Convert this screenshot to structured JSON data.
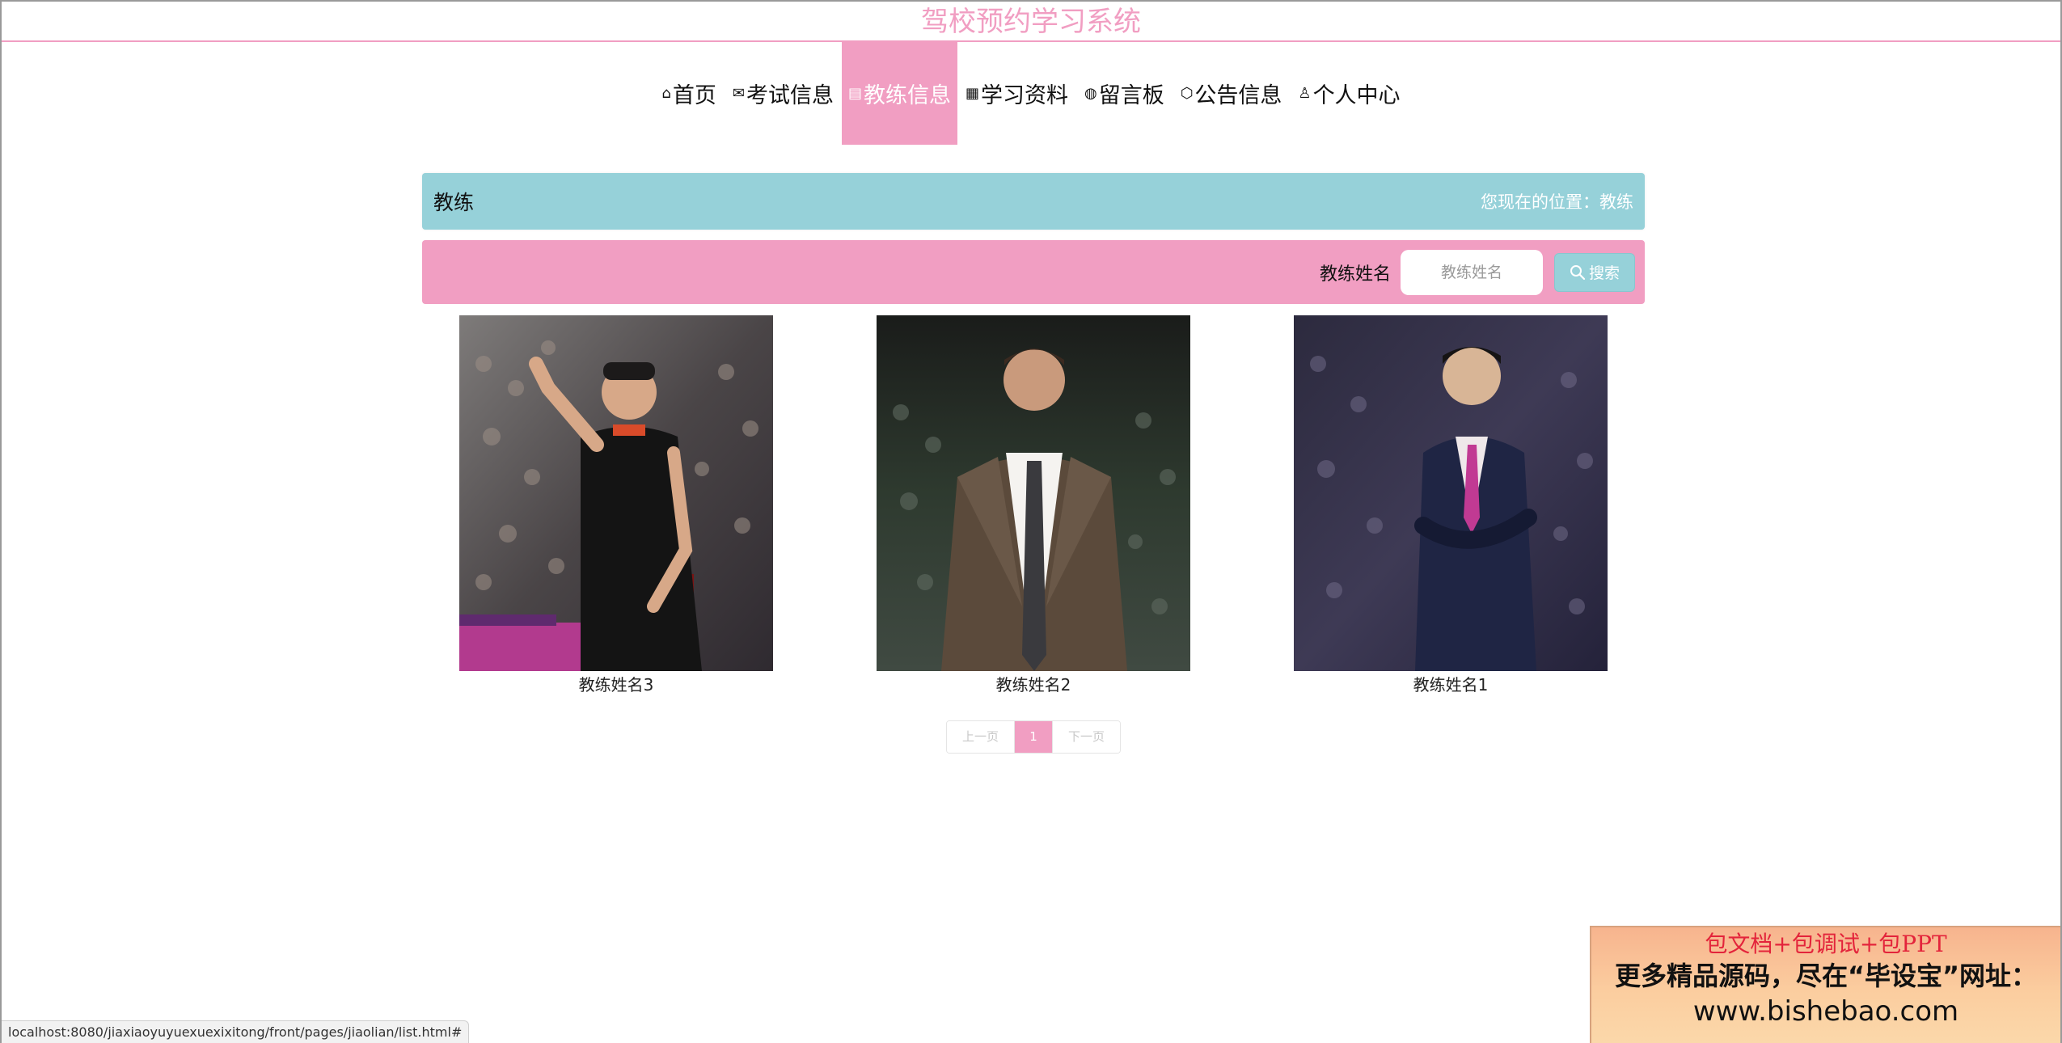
{
  "header": {
    "site_title": "驾校预约学习系统"
  },
  "nav": {
    "items": [
      {
        "label": "首页",
        "icon": "home-icon",
        "glyph": "⌂",
        "active": false
      },
      {
        "label": "考试信息",
        "icon": "mail-icon",
        "glyph": "✉",
        "active": false
      },
      {
        "label": "教练信息",
        "icon": "calendar-icon",
        "glyph": "▤",
        "active": true
      },
      {
        "label": "学习资料",
        "icon": "grid-icon",
        "glyph": "▦",
        "active": false
      },
      {
        "label": "留言板",
        "icon": "globe-icon",
        "glyph": "◍",
        "active": false
      },
      {
        "label": "公告信息",
        "icon": "box-icon",
        "glyph": "⬡",
        "active": false
      },
      {
        "label": "个人中心",
        "icon": "user-icon",
        "glyph": "♙",
        "active": false
      }
    ]
  },
  "banner": {
    "title": "教练",
    "breadcrumb": "您现在的位置：教练"
  },
  "search": {
    "label": "教练姓名",
    "placeholder": "教练姓名",
    "button_label": "搜索"
  },
  "coaches": [
    {
      "name": "教练姓名3"
    },
    {
      "name": "教练姓名2"
    },
    {
      "name": "教练姓名1"
    }
  ],
  "pagination": {
    "prev_label": "上一页",
    "current_page": "1",
    "next_label": "下一页"
  },
  "status_bar": {
    "url": "localhost:8080/jiaxiaoyuyuexuexixitong/front/pages/jiaolian/list.html#"
  },
  "ad": {
    "line1": "包文档+包调试+包PPT",
    "line2": "更多精品源码，尽在“毕设宝”网址：",
    "line3": "www.bishebao.com"
  },
  "colors": {
    "accent_pink": "#f19ec2",
    "accent_teal": "#96d1d9"
  }
}
